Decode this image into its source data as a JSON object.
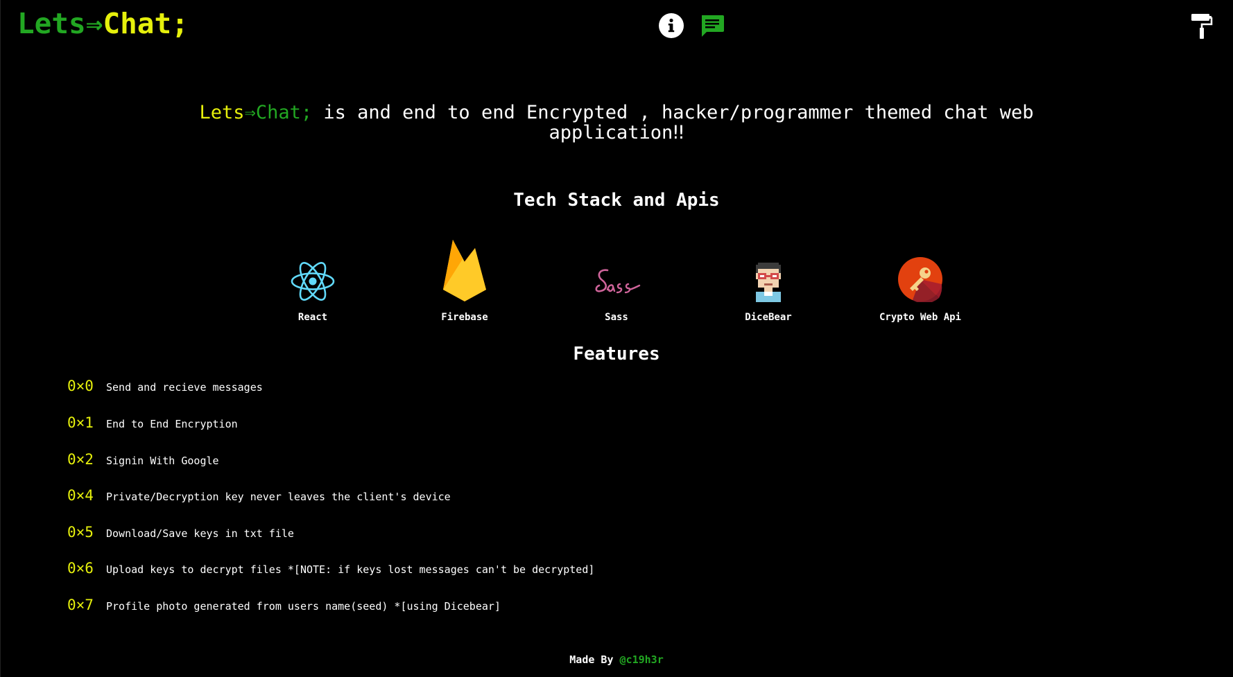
{
  "header": {
    "logo_lets": "Lets",
    "logo_arrow": "⇒",
    "logo_chat": "Chat;",
    "icons": [
      "info-icon",
      "chat-icon",
      "paint-roller-icon"
    ]
  },
  "intro": {
    "brand_lets": "Lets",
    "brand_arrow": "⇒",
    "brand_chat": "Chat;",
    "text": " is and end to end Encrypted , hacker/programmer themed chat web application‼"
  },
  "tech_section": {
    "title": "Tech Stack and Apis",
    "items": [
      {
        "name": "React",
        "icon": "react-logo"
      },
      {
        "name": "Firebase",
        "icon": "firebase-logo"
      },
      {
        "name": "Sass",
        "icon": "sass-logo"
      },
      {
        "name": "DiceBear",
        "icon": "dicebear-avatar"
      },
      {
        "name": "Crypto Web Api",
        "icon": "crypto-key-logo"
      }
    ]
  },
  "features_section": {
    "title": "Features",
    "items": [
      {
        "index": "0×0",
        "text": "Send and recieve messages"
      },
      {
        "index": "0×1",
        "text": "End to End Encryption"
      },
      {
        "index": "0×2",
        "text": "Signin With Google"
      },
      {
        "index": "0×4",
        "text": "Private/Decryption key never leaves the client's device"
      },
      {
        "index": "0×5",
        "text": "Download/Save keys in txt file"
      },
      {
        "index": "0×6",
        "text": "Upload keys to decrypt files *[NOTE: if keys lost messages can't be decrypted]"
      },
      {
        "index": "0×7",
        "text": "Profile photo generated from users name(seed) *[using Dicebear]"
      }
    ]
  },
  "footer": {
    "label": "Made By ",
    "handle": "@c19h3r"
  },
  "colors": {
    "background": "#000000",
    "accent_green": "#22a722",
    "accent_yellow": "#e6f00c",
    "text": "#ffffff"
  }
}
